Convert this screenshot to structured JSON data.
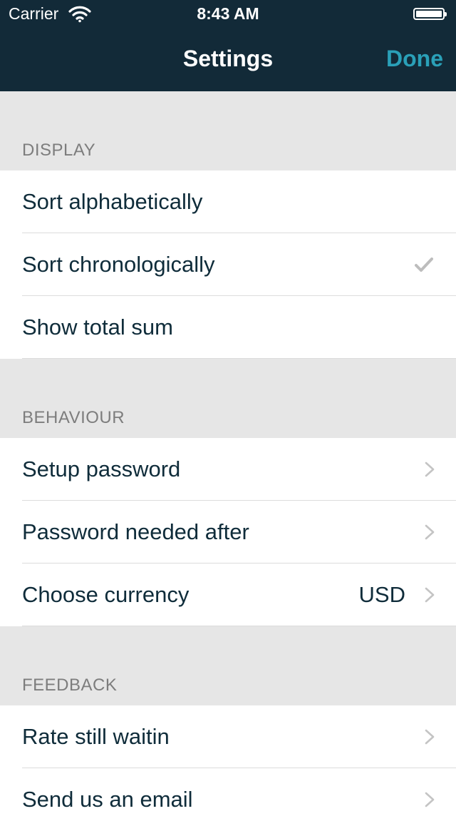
{
  "status_bar": {
    "carrier": "Carrier",
    "time": "8:43 AM"
  },
  "nav": {
    "title": "Settings",
    "done_label": "Done"
  },
  "sections": [
    {
      "header": "DISPLAY",
      "rows": [
        {
          "label": "Sort alphabetically",
          "accessory": "none"
        },
        {
          "label": "Sort chronologically",
          "accessory": "checkmark-icon"
        },
        {
          "label": "Show total sum",
          "accessory": "none"
        }
      ]
    },
    {
      "header": "BEHAVIOUR",
      "rows": [
        {
          "label": "Setup password",
          "accessory": "chevron-right-icon"
        },
        {
          "label": "Password needed after",
          "accessory": "chevron-right-icon"
        },
        {
          "label": "Choose currency",
          "value": "USD",
          "accessory": "chevron-right-icon"
        }
      ]
    },
    {
      "header": "FEEDBACK",
      "rows": [
        {
          "label": "Rate still waitin",
          "accessory": "chevron-right-icon"
        },
        {
          "label": "Send us an email",
          "accessory": "chevron-right-icon"
        }
      ]
    }
  ],
  "colors": {
    "nav_bg": "#122a38",
    "accent": "#2aa0b8",
    "text": "#0f2c3a",
    "section_bg": "#e6e6e6"
  }
}
